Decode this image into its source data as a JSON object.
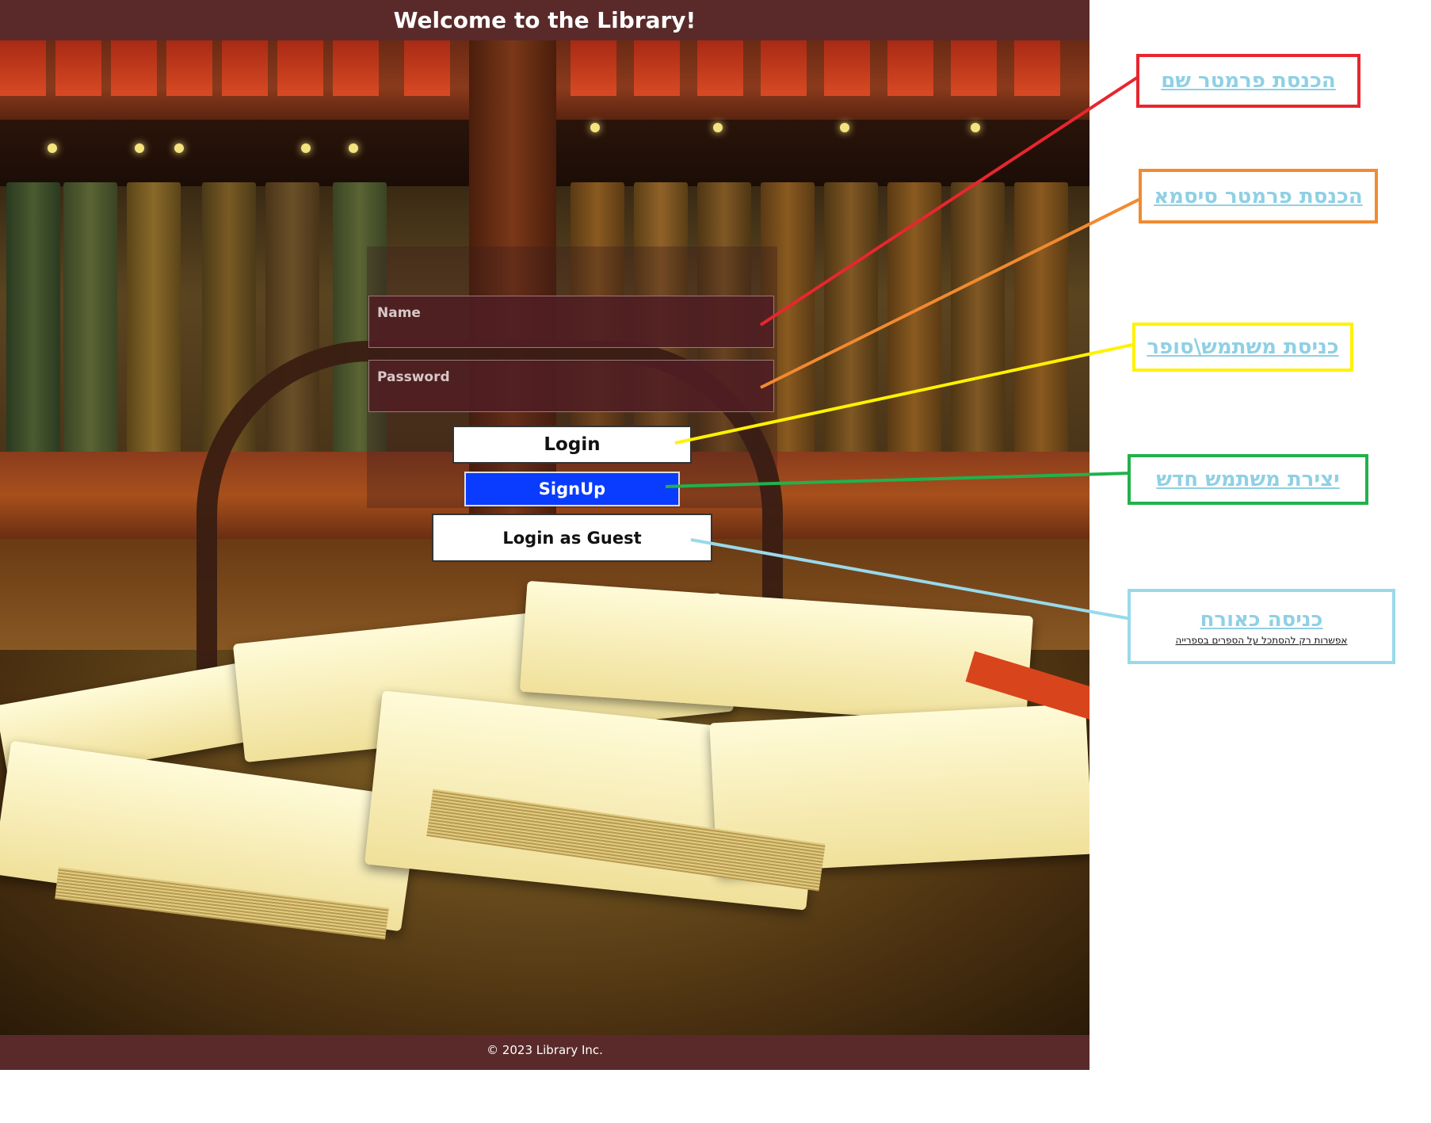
{
  "header": {
    "title": "Welcome to the Library!"
  },
  "form": {
    "name_placeholder": "Name",
    "password_placeholder": "Password",
    "login_label": "Login",
    "signup_label": "SignUp",
    "guest_label": "Login as Guest"
  },
  "footer": {
    "text": "© 2023 Library Inc."
  },
  "annotations": {
    "name": {
      "label": "הכנסת פרמטר שם",
      "color": "#e8262e"
    },
    "password": {
      "label": "הכנסת פרמטר סיסמא",
      "color": "#f28a30"
    },
    "login": {
      "label": "כניסת משתמש\\סופר",
      "color": "#fff200"
    },
    "signup": {
      "label": "יצירת משתמש חדש",
      "color": "#22b14c"
    },
    "guest": {
      "label": "כניסה כאורח",
      "sublabel": "אפשרות רק להסתכל על הספרים בספרייה",
      "color": "#99d9ea"
    }
  },
  "colors": {
    "header_bg": "#5a2a2a",
    "signup_bg": "#0a3cff",
    "annotation_text": "#8fd0e4"
  }
}
